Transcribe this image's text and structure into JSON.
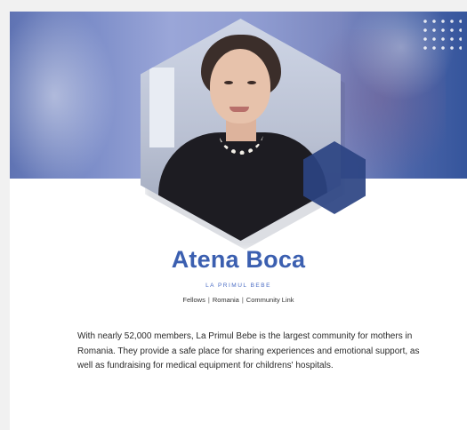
{
  "profile": {
    "name": "Atena Boca",
    "organization": "LA PRIMUL BEBE",
    "meta": {
      "category": "Fellows",
      "separator": "|",
      "country": "Romania",
      "link_label": "Community Link"
    },
    "description": "With nearly 52,000 members, La Primul Bebe is the largest community for mothers in Romania. They provide a safe place for sharing experiences and emotional support, as well as fundraising for medical equipment for childrens' hospitals."
  },
  "colors": {
    "accent": "#3b5fb0",
    "banner": "#7d8ec9",
    "hex_accent": "#2b4382"
  }
}
